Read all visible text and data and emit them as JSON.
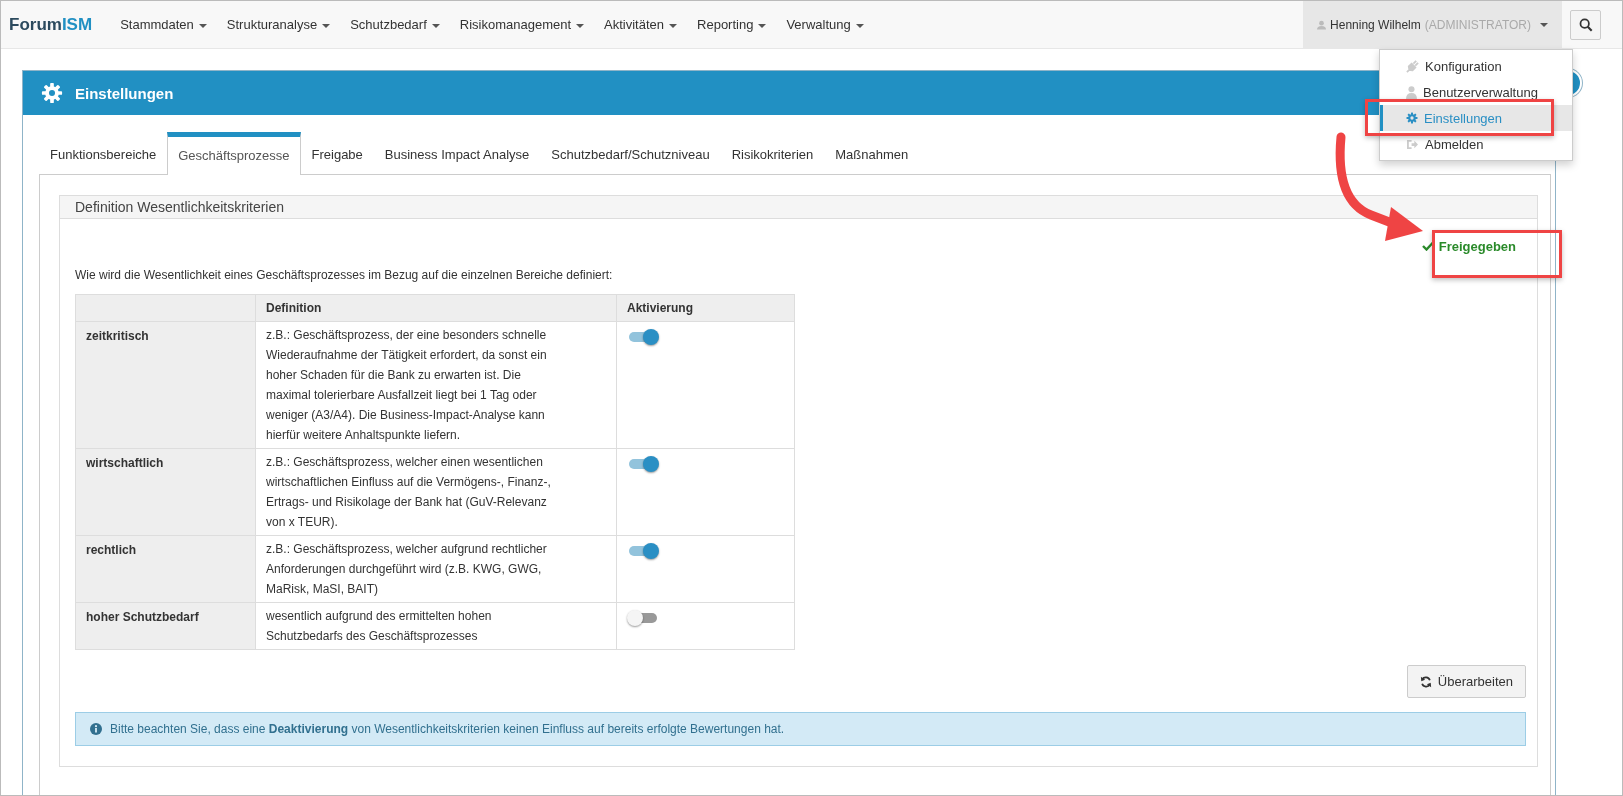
{
  "navbar": {
    "brand": {
      "prefix": "Forum",
      "accent": "ISM"
    },
    "menus": [
      "Stammdaten",
      "Strukturanalyse",
      "Schutzbedarf",
      "Risikomanagement",
      "Aktivitäten",
      "Reporting",
      "Verwaltung"
    ],
    "user": {
      "name": "Henning Wilhelm",
      "role": "(ADMINISTRATOR)"
    }
  },
  "user_menu": [
    {
      "label": "Konfiguration",
      "kind": "plug",
      "selected": false
    },
    {
      "label": "Benutzerverwaltung",
      "kind": "users",
      "selected": false
    },
    {
      "label": "Einstellungen",
      "kind": "gear",
      "selected": true
    },
    {
      "label": "Abmelden",
      "kind": "logout",
      "selected": false
    }
  ],
  "panel": {
    "title": "Einstellungen"
  },
  "tabs": [
    {
      "label": "Funktionsbereiche",
      "selected": false
    },
    {
      "label": "Geschäftsprozesse",
      "selected": true
    },
    {
      "label": "Freigabe",
      "selected": false
    },
    {
      "label": "Business Impact Analyse",
      "selected": false
    },
    {
      "label": "Schutzbedarf/Schutzniveau",
      "selected": false
    },
    {
      "label": "Risikokriterien",
      "selected": false
    },
    {
      "label": "Maßnahmen",
      "selected": false
    }
  ],
  "section": {
    "title": "Definition Wesentlichkeitskriterien",
    "status": "Freigegeben",
    "intro": "Wie wird die Wesentlichkeit eines Geschäftsprozesses im Bezug auf die einzelnen Bereiche definiert:"
  },
  "table": {
    "columns": [
      "Definition",
      "Aktivierung"
    ],
    "rows": [
      {
        "name": "zeitkritisch",
        "definition": "z.B.: Geschäftsprozess, der eine besonders schnelle Wiederaufnahme der Tätigkeit erfordert, da sonst ein hoher Schaden für die Bank zu erwarten ist. Die maximal tolerierbare Ausfallzeit liegt bei 1 Tag oder weniger (A3/A4). Die Business-Impact-Analyse kann hierfür weitere Anhaltspunkte liefern.",
        "on": true
      },
      {
        "name": "wirtschaftlich",
        "definition": "z.B.: Geschäftsprozess, welcher einen wesentlichen wirtschaftlichen Einfluss auf die Vermögens-, Finanz-, Ertrags- und Risikolage der Bank hat (GuV-Relevanz von x TEUR).",
        "on": true
      },
      {
        "name": "rechtlich",
        "definition": "z.B.: Geschäftsprozess, welcher aufgrund rechtlicher Anforderungen durchgeführt wird (z.B. KWG, GWG, MaRisk, MaSI, BAIT)",
        "on": true
      },
      {
        "name": "hoher Schutzbedarf",
        "definition": "wesentlich aufgrund des ermittelten hohen Schutzbedarfs des Geschäftsprozesses",
        "on": false
      }
    ]
  },
  "button": "Überarbeiten",
  "info": "Bitte beachten Sie, dass eine **Deaktivierung** von Wesentlichkeitskriterien keinen Einfluss auf bereits erfolgte Bewertungen hat."
}
